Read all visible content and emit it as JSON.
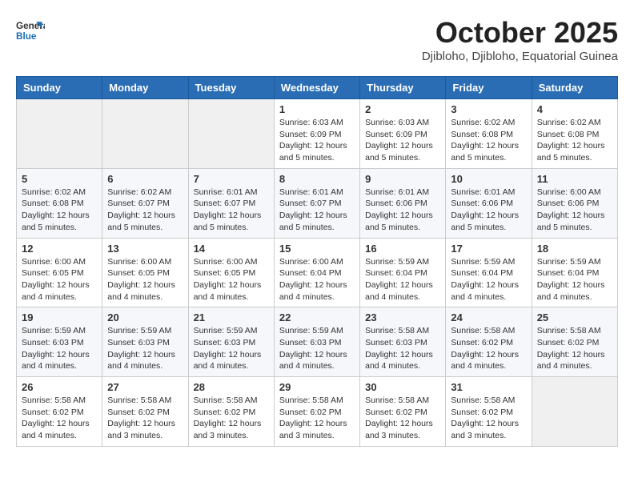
{
  "header": {
    "logo_general": "General",
    "logo_blue": "Blue",
    "month": "October 2025",
    "location": "Djibloho, Djibloho, Equatorial Guinea"
  },
  "days_of_week": [
    "Sunday",
    "Monday",
    "Tuesday",
    "Wednesday",
    "Thursday",
    "Friday",
    "Saturday"
  ],
  "weeks": [
    [
      {
        "day": "",
        "info": ""
      },
      {
        "day": "",
        "info": ""
      },
      {
        "day": "",
        "info": ""
      },
      {
        "day": "1",
        "info": "Sunrise: 6:03 AM\nSunset: 6:09 PM\nDaylight: 12 hours\nand 5 minutes."
      },
      {
        "day": "2",
        "info": "Sunrise: 6:03 AM\nSunset: 6:09 PM\nDaylight: 12 hours\nand 5 minutes."
      },
      {
        "day": "3",
        "info": "Sunrise: 6:02 AM\nSunset: 6:08 PM\nDaylight: 12 hours\nand 5 minutes."
      },
      {
        "day": "4",
        "info": "Sunrise: 6:02 AM\nSunset: 6:08 PM\nDaylight: 12 hours\nand 5 minutes."
      }
    ],
    [
      {
        "day": "5",
        "info": "Sunrise: 6:02 AM\nSunset: 6:08 PM\nDaylight: 12 hours\nand 5 minutes."
      },
      {
        "day": "6",
        "info": "Sunrise: 6:02 AM\nSunset: 6:07 PM\nDaylight: 12 hours\nand 5 minutes."
      },
      {
        "day": "7",
        "info": "Sunrise: 6:01 AM\nSunset: 6:07 PM\nDaylight: 12 hours\nand 5 minutes."
      },
      {
        "day": "8",
        "info": "Sunrise: 6:01 AM\nSunset: 6:07 PM\nDaylight: 12 hours\nand 5 minutes."
      },
      {
        "day": "9",
        "info": "Sunrise: 6:01 AM\nSunset: 6:06 PM\nDaylight: 12 hours\nand 5 minutes."
      },
      {
        "day": "10",
        "info": "Sunrise: 6:01 AM\nSunset: 6:06 PM\nDaylight: 12 hours\nand 5 minutes."
      },
      {
        "day": "11",
        "info": "Sunrise: 6:00 AM\nSunset: 6:06 PM\nDaylight: 12 hours\nand 5 minutes."
      }
    ],
    [
      {
        "day": "12",
        "info": "Sunrise: 6:00 AM\nSunset: 6:05 PM\nDaylight: 12 hours\nand 4 minutes."
      },
      {
        "day": "13",
        "info": "Sunrise: 6:00 AM\nSunset: 6:05 PM\nDaylight: 12 hours\nand 4 minutes."
      },
      {
        "day": "14",
        "info": "Sunrise: 6:00 AM\nSunset: 6:05 PM\nDaylight: 12 hours\nand 4 minutes."
      },
      {
        "day": "15",
        "info": "Sunrise: 6:00 AM\nSunset: 6:04 PM\nDaylight: 12 hours\nand 4 minutes."
      },
      {
        "day": "16",
        "info": "Sunrise: 5:59 AM\nSunset: 6:04 PM\nDaylight: 12 hours\nand 4 minutes."
      },
      {
        "day": "17",
        "info": "Sunrise: 5:59 AM\nSunset: 6:04 PM\nDaylight: 12 hours\nand 4 minutes."
      },
      {
        "day": "18",
        "info": "Sunrise: 5:59 AM\nSunset: 6:04 PM\nDaylight: 12 hours\nand 4 minutes."
      }
    ],
    [
      {
        "day": "19",
        "info": "Sunrise: 5:59 AM\nSunset: 6:03 PM\nDaylight: 12 hours\nand 4 minutes."
      },
      {
        "day": "20",
        "info": "Sunrise: 5:59 AM\nSunset: 6:03 PM\nDaylight: 12 hours\nand 4 minutes."
      },
      {
        "day": "21",
        "info": "Sunrise: 5:59 AM\nSunset: 6:03 PM\nDaylight: 12 hours\nand 4 minutes."
      },
      {
        "day": "22",
        "info": "Sunrise: 5:59 AM\nSunset: 6:03 PM\nDaylight: 12 hours\nand 4 minutes."
      },
      {
        "day": "23",
        "info": "Sunrise: 5:58 AM\nSunset: 6:03 PM\nDaylight: 12 hours\nand 4 minutes."
      },
      {
        "day": "24",
        "info": "Sunrise: 5:58 AM\nSunset: 6:02 PM\nDaylight: 12 hours\nand 4 minutes."
      },
      {
        "day": "25",
        "info": "Sunrise: 5:58 AM\nSunset: 6:02 PM\nDaylight: 12 hours\nand 4 minutes."
      }
    ],
    [
      {
        "day": "26",
        "info": "Sunrise: 5:58 AM\nSunset: 6:02 PM\nDaylight: 12 hours\nand 4 minutes."
      },
      {
        "day": "27",
        "info": "Sunrise: 5:58 AM\nSunset: 6:02 PM\nDaylight: 12 hours\nand 3 minutes."
      },
      {
        "day": "28",
        "info": "Sunrise: 5:58 AM\nSunset: 6:02 PM\nDaylight: 12 hours\nand 3 minutes."
      },
      {
        "day": "29",
        "info": "Sunrise: 5:58 AM\nSunset: 6:02 PM\nDaylight: 12 hours\nand 3 minutes."
      },
      {
        "day": "30",
        "info": "Sunrise: 5:58 AM\nSunset: 6:02 PM\nDaylight: 12 hours\nand 3 minutes."
      },
      {
        "day": "31",
        "info": "Sunrise: 5:58 AM\nSunset: 6:02 PM\nDaylight: 12 hours\nand 3 minutes."
      },
      {
        "day": "",
        "info": ""
      }
    ]
  ]
}
